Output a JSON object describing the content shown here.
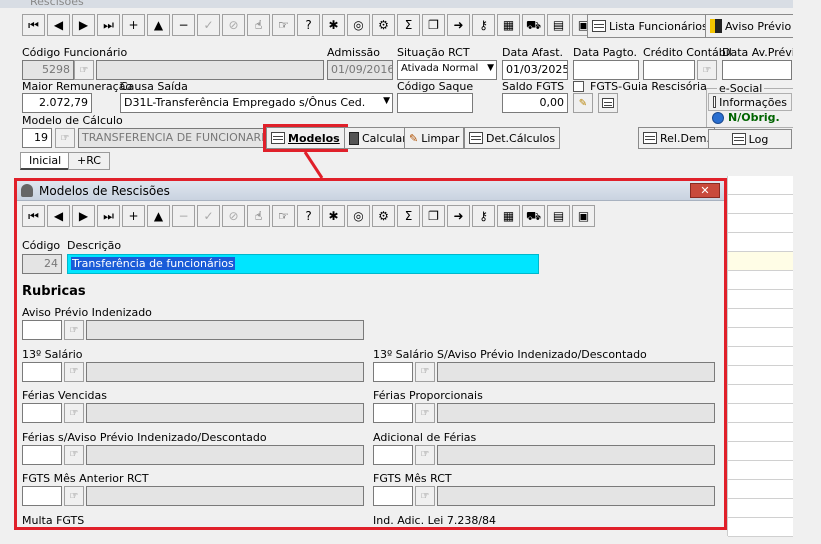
{
  "window": {
    "title": "Rescisões"
  },
  "toolbar": {
    "buttons": [
      "first",
      "prev",
      "next",
      "last",
      "add",
      "up",
      "remove",
      "check",
      "cancel",
      "hand",
      "pointer",
      "help",
      "bug",
      "target",
      "tools",
      "sigma",
      "copy",
      "exit",
      "key",
      "print",
      "car",
      "calendar",
      "square"
    ],
    "lista_funcionarios": "Lista Funcionários",
    "aviso_previo": "Aviso Prévio"
  },
  "form": {
    "codigo_funcionario": {
      "label": "Código Funcionário",
      "value": "5298"
    },
    "admissao": {
      "label": "Admissão",
      "value": "01/09/2016"
    },
    "situacao_rct": {
      "label": "Situação RCT",
      "value": "Ativada Normal"
    },
    "data_afast": {
      "label": "Data Afast.",
      "value": "01/03/2025"
    },
    "data_pagto": {
      "label": "Data Pagto.",
      "value": ""
    },
    "credito_contabil": {
      "label": "Crédito Contábil",
      "value": ""
    },
    "data_av_previo": {
      "label": "Data Av.Prévio",
      "value": ""
    },
    "maior_remuneracao": {
      "label": "Maior Remuneração",
      "value": "2.072,79"
    },
    "causa_saida": {
      "label": "Causa Saída",
      "value": "D31L-Transferência Empregado s/Ônus Ced."
    },
    "codigo_saque": {
      "label": "Código Saque",
      "value": ""
    },
    "saldo_fgts": {
      "label": "Saldo FGTS",
      "value": "0,00"
    },
    "fgts_guia": {
      "label": "FGTS-Guia Rescisória"
    },
    "esocial": {
      "label": "e-Social",
      "informacoes": "Informações",
      "status": "N/Obrig."
    },
    "modelo_calculo": {
      "label": "Modelo de Cálculo",
      "code": "19",
      "name": "TRANSFERENCIA DE FUNCIONARIO"
    },
    "buttons": {
      "modelos": "Modelos",
      "calcular": "Calcular",
      "limpar": "Limpar",
      "det_calculos": "Det.Cálculos",
      "rel_dem": "Rel.Dem.",
      "log": "Log"
    },
    "tabs": [
      "Inicial",
      "+RC"
    ]
  },
  "modal": {
    "title": "Modelos de Rescisões",
    "codigo_label": "Código",
    "descricao_label": "Descrição",
    "codigo": "24",
    "descricao": "Transferência de funcionários",
    "rubricas_title": "Rubricas",
    "rubricas": [
      {
        "label": "Aviso Prévio Indenizado",
        "col": "left",
        "row": 0
      },
      {
        "label": "13º Salário",
        "col": "left",
        "row": 1
      },
      {
        "label": "13º Salário S/Aviso Prévio Indenizado/Descontado",
        "col": "right",
        "row": 1
      },
      {
        "label": "Férias Vencidas",
        "col": "left",
        "row": 2
      },
      {
        "label": "Férias Proporcionais",
        "col": "right",
        "row": 2
      },
      {
        "label": "Férias s/Aviso Prévio Indenizado/Descontado",
        "col": "left",
        "row": 3
      },
      {
        "label": "Adicional de Férias",
        "col": "right",
        "row": 3
      },
      {
        "label": "FGTS Mês Anterior RCT",
        "col": "left",
        "row": 4
      },
      {
        "label": "FGTS Mês RCT",
        "col": "right",
        "row": 4
      },
      {
        "label": "Multa FGTS",
        "col": "left",
        "row": 5
      },
      {
        "label": "Ind. Adic. Lei 7.238/84",
        "col": "right",
        "row": 5
      }
    ]
  },
  "colors": {
    "highlight": "#e0202a",
    "selection": "#00e5ff",
    "esocial_status": "#006400"
  }
}
